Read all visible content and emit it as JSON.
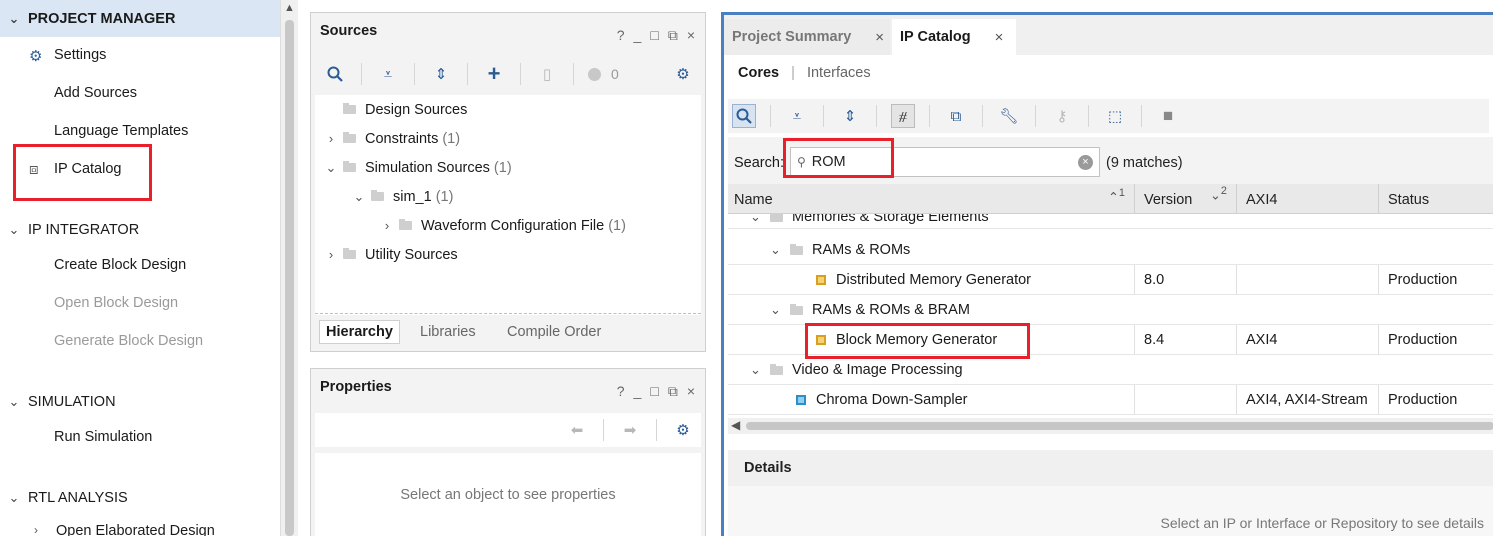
{
  "flow_navigator": {
    "project_manager": "PROJECT MANAGER",
    "pm_items": [
      "Settings",
      "Add Sources",
      "Language Templates",
      "IP Catalog"
    ],
    "ip_integrator": "IP INTEGRATOR",
    "ii_items": [
      "Create Block Design",
      "Open Block Design",
      "Generate Block Design"
    ],
    "simulation": "SIMULATION",
    "sim_items": [
      "Run Simulation"
    ],
    "rtl_analysis": "RTL ANALYSIS",
    "rtl_items": [
      "Open Elaborated Design"
    ]
  },
  "sources": {
    "title": "Sources",
    "controls": [
      "?",
      "_",
      "□",
      "⧉",
      "×"
    ],
    "error_count": "0",
    "tree": [
      {
        "label": "Design Sources",
        "count": ""
      },
      {
        "label": "Constraints",
        "count": "(1)"
      },
      {
        "label": "Simulation Sources",
        "count": "(1)"
      },
      {
        "label": "sim_1",
        "count": "(1)"
      },
      {
        "label": "Waveform Configuration File",
        "count": "(1)"
      },
      {
        "label": "Utility Sources",
        "count": ""
      }
    ],
    "tabs": [
      "Hierarchy",
      "Libraries",
      "Compile Order"
    ]
  },
  "properties": {
    "title": "Properties",
    "controls": [
      "?",
      "_",
      "□",
      "⧉",
      "×"
    ],
    "empty_message": "Select an object to see properties"
  },
  "ip_catalog": {
    "doc_tabs": [
      "Project Summary",
      "IP Catalog"
    ],
    "sub_tabs": [
      "Cores",
      "Interfaces"
    ],
    "search_label": "Search:",
    "search_value": "ROM",
    "matches": "(9 matches)",
    "columns": [
      "Name",
      "Version",
      "AXI4",
      "Status"
    ],
    "sort_markers": [
      "1",
      "2"
    ],
    "rows": [
      {
        "name": "Memories & Storage Elements",
        "version": "",
        "axi": "",
        "status": ""
      },
      {
        "name": "RAMs & ROMs",
        "version": "",
        "axi": "",
        "status": ""
      },
      {
        "name": "Distributed Memory Generator",
        "version": "8.0",
        "axi": "",
        "status": "Production"
      },
      {
        "name": "RAMs & ROMs & BRAM",
        "version": "",
        "axi": "",
        "status": ""
      },
      {
        "name": "Block Memory Generator",
        "version": "8.4",
        "axi": "AXI4",
        "status": "Production"
      },
      {
        "name": "Video & Image Processing",
        "version": "",
        "axi": "",
        "status": ""
      },
      {
        "name": "Chroma Down-Sampler",
        "version": "",
        "axi": "AXI4, AXI4-Stream",
        "status": "Production"
      }
    ],
    "details_title": "Details",
    "details_message": "Select an IP or Interface or Repository to see details"
  },
  "colors": {
    "highlight": "#e8202b",
    "accent": "#4a7fc2",
    "selection": "#dbe6f4"
  }
}
